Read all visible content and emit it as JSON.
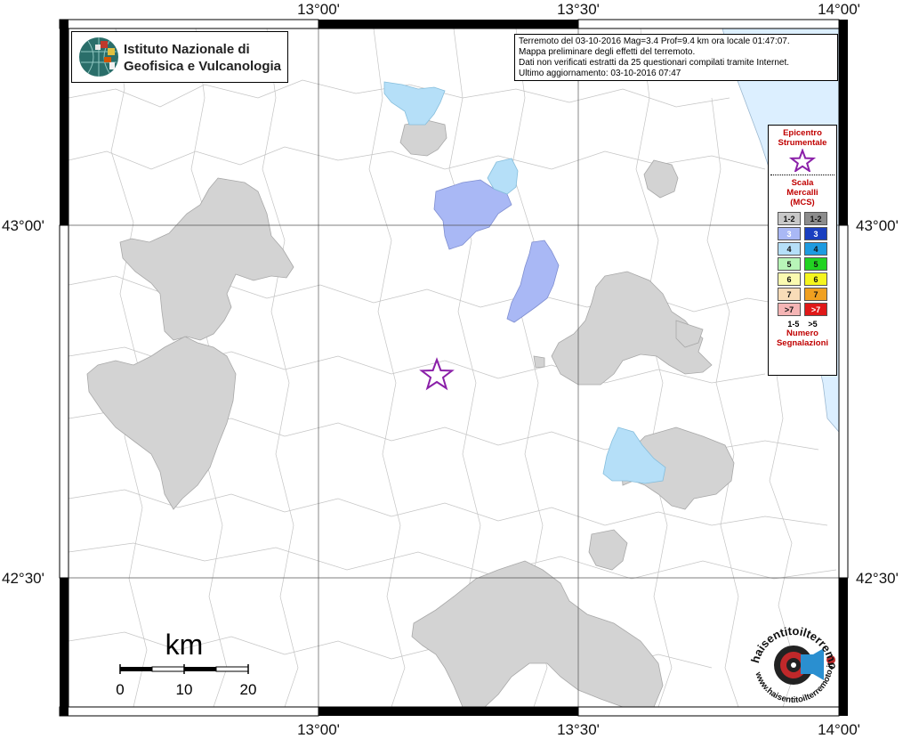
{
  "axes": {
    "top_labels": [
      "13°00'",
      "13°30'",
      "14°00'"
    ],
    "bottom_labels": [
      "13°00'",
      "13°30'",
      "14°00'"
    ],
    "left_labels": [
      "43°00'",
      "42°30'"
    ],
    "right_labels": [
      "43°00'",
      "42°30'"
    ]
  },
  "logo": {
    "line1": "Istituto Nazionale di",
    "line2": "Geofisica e Vulcanologia"
  },
  "info": {
    "line1": "Terremoto del 03-10-2016 Mag=3.4 Prof=9.4 km ora locale 01:47:07.",
    "line2": "Mappa preliminare degli effetti del terremoto.",
    "line3": "Dati non verificati estratti da 25 questionari compilati tramite Internet.",
    "line4": "Ultimo aggiornamento: 03-10-2016 07:47"
  },
  "legend": {
    "epicenter_line1": "Epicentro",
    "epicenter_line2": "Strumentale",
    "scale_line1": "Scala",
    "scale_line2": "Mercalli",
    "scale_line3": "(MCS)",
    "rows": [
      {
        "label_left": "1-2",
        "label_right": "1-2",
        "color_left": "#c8c8c8",
        "color_right": "#8c8c8c"
      },
      {
        "label_left": "3",
        "label_right": "3",
        "color_left": "#a9b8f5",
        "color_right": "#1a3fc0"
      },
      {
        "label_left": "4",
        "label_right": "4",
        "color_left": "#b5dff8",
        "color_right": "#1e9be0"
      },
      {
        "label_left": "5",
        "label_right": "5",
        "color_left": "#b8f5b8",
        "color_right": "#22d322"
      },
      {
        "label_left": "6",
        "label_right": "6",
        "color_left": "#fafab0",
        "color_right": "#f5f51e"
      },
      {
        "label_left": "7",
        "label_right": "7",
        "color_left": "#f8dcb8",
        "color_right": "#f0a020"
      },
      {
        "label_left": ">7",
        "label_right": ">7",
        "color_left": "#f5b5b5",
        "color_right": "#e01818"
      }
    ],
    "count_left": "1-5",
    "count_right": ">5",
    "count_line1": "Numero",
    "count_line2": "Segnalazioni"
  },
  "scale_bar": {
    "unit": "km",
    "ticks": [
      "0",
      "10",
      "20"
    ]
  },
  "footer_logo": {
    "text_top": "haisentitoilterremoto.it",
    "text_bottom": "www.haisentitoilterremoto.it"
  },
  "colors": {
    "sea": "#dcefff",
    "grey_area": "#d3d3d3",
    "intensity3": "#a9b8f5",
    "intensity4": "#b5dff8",
    "epicenter": "#8a1fa8",
    "legend_title": "#c00000"
  }
}
